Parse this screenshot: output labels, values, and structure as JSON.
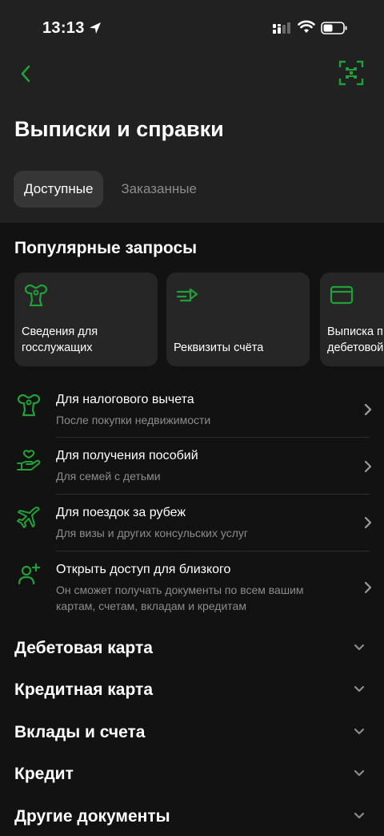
{
  "status_bar": {
    "time": "13:13"
  },
  "header": {
    "title": "Выписки и справки"
  },
  "tabs": [
    {
      "label": "Доступные",
      "active": true
    },
    {
      "label": "Заказанные",
      "active": false
    }
  ],
  "popular": {
    "title": "Популярные запросы",
    "cards": [
      {
        "label": "Сведения для\nгосслужащих",
        "icon": "eagle-icon"
      },
      {
        "label": "Реквизиты счёта",
        "icon": "arrow-right-icon"
      },
      {
        "label": "Выписка п\nдебетовой",
        "icon": "card-icon"
      }
    ]
  },
  "list": [
    {
      "title": "Для налогового вычета",
      "subtitle": "После покупки недвижимости",
      "icon": "eagle-icon"
    },
    {
      "title": "Для получения пособий",
      "subtitle": "Для семей с детьми",
      "icon": "hand-heart-icon"
    },
    {
      "title": "Для поездок за рубеж",
      "subtitle": "Для визы и других консульских услуг",
      "icon": "plane-icon"
    },
    {
      "title": "Открыть доступ для близкого",
      "subtitle": "Он сможет получать документы по всем вашим картам, счетам, вкладам и кредитам",
      "icon": "add-user-icon"
    }
  ],
  "accordions": [
    {
      "label": "Дебетовая карта"
    },
    {
      "label": "Кредитная карта"
    },
    {
      "label": "Вклады и счета"
    },
    {
      "label": "Кредит"
    },
    {
      "label": "Другие документы"
    }
  ],
  "colors": {
    "accent": "#21a038",
    "background": "#121212",
    "surface": "#262626",
    "header_bg": "#212121",
    "muted_text": "#8c8c8c"
  }
}
